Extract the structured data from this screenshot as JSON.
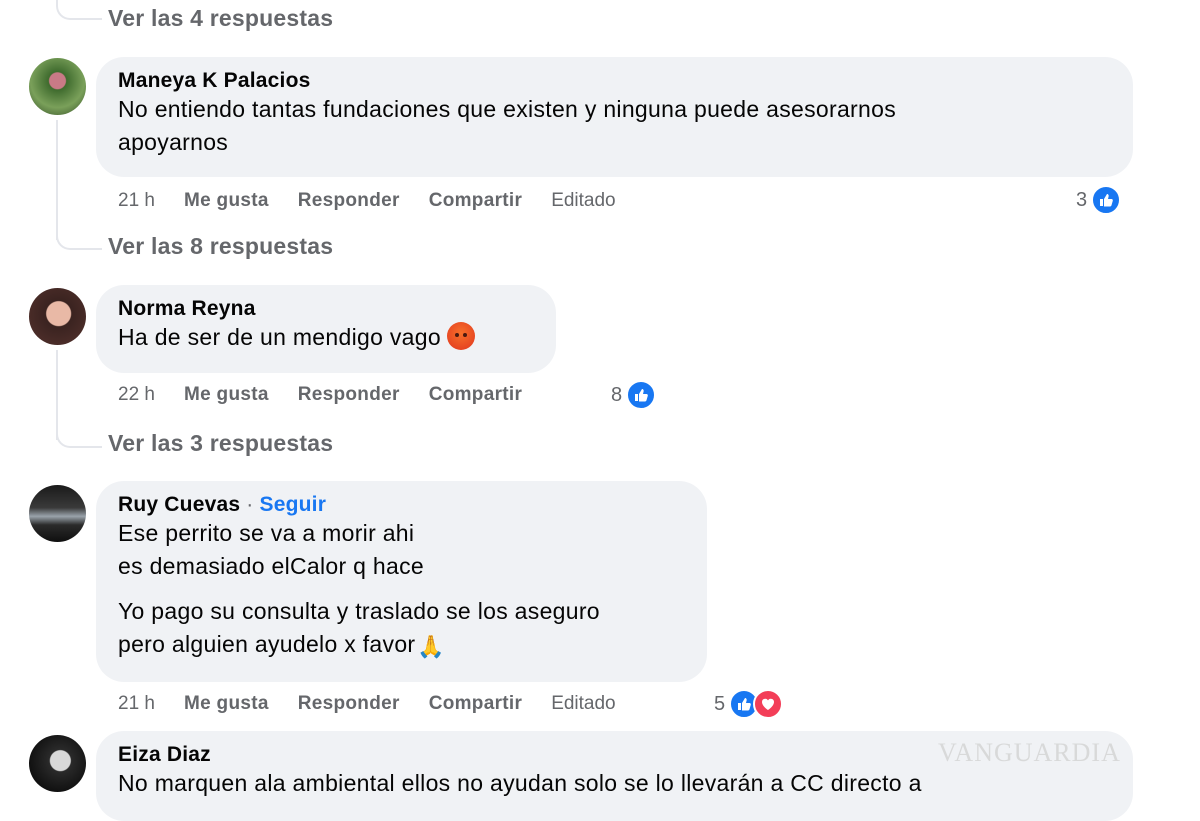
{
  "replies_link_1": "Ver las 4 respuestas",
  "replies_link_2": "Ver las 8 respuestas",
  "replies_link_3": "Ver las 3 respuestas",
  "comments": [
    {
      "author": "Maneya K Palacios",
      "lines": [
        "No entiendo tantas fundaciones que existen y ninguna puede asesorarnos",
        "apoyarnos"
      ],
      "time": "21 h",
      "like": "Me gusta",
      "reply": "Responder",
      "share": "Compartir",
      "edited": "Editado",
      "reaction_count": "3"
    },
    {
      "author": "Norma Reyna",
      "lines": [
        "Ha de ser de un mendigo vago"
      ],
      "time": "22 h",
      "like": "Me gusta",
      "reply": "Responder",
      "share": "Compartir",
      "reaction_count": "8"
    },
    {
      "author": "Ruy Cuevas",
      "separator": "·",
      "follow": "Seguir",
      "lines": [
        "Ese perrito se va a morir ahi",
        "es demasiado elCalor q hace"
      ],
      "lines2": [
        "Yo pago su consulta y traslado se los aseguro",
        "pero alguien ayudelo x favor"
      ],
      "time": "21 h",
      "like": "Me gusta",
      "reply": "Responder",
      "share": "Compartir",
      "edited": "Editado",
      "reaction_count": "5"
    },
    {
      "author": "Eiza Diaz",
      "lines": [
        "No marquen ala ambiental ellos no ayudan solo se lo llevarán a CC directo a"
      ]
    }
  ],
  "watermark": "VANGUARDIA",
  "colors": {
    "bubble": "#f0f2f5",
    "link": "#1877f2",
    "meta": "#65676b",
    "like": "#1877f2",
    "love": "#f33e58"
  },
  "icons": [
    "like-icon",
    "love-icon",
    "angry-face-emoji",
    "folded-hands-emoji"
  ]
}
